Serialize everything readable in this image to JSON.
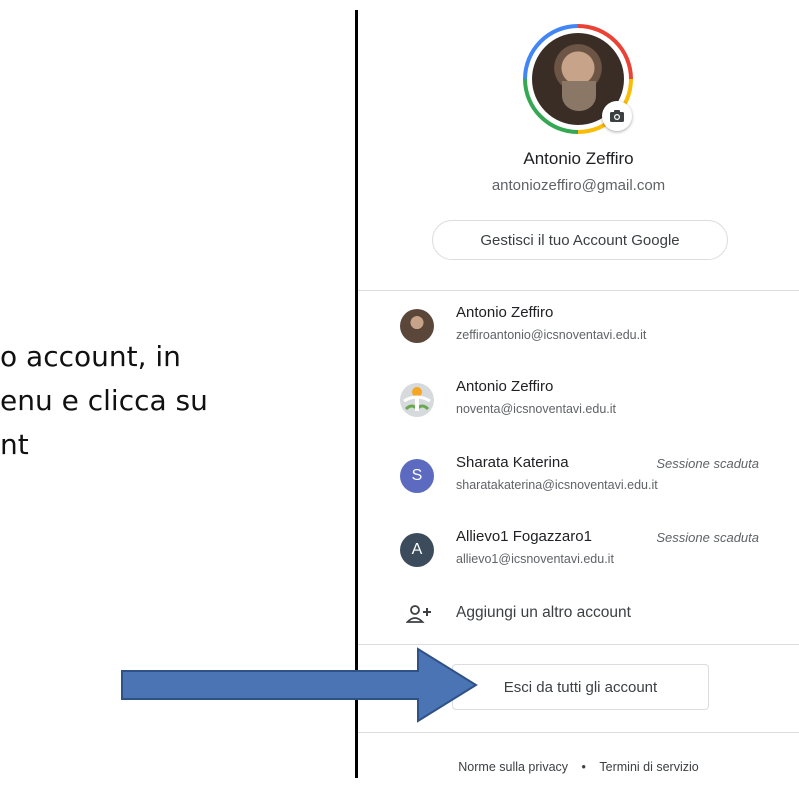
{
  "slide": {
    "line1": "o account, in",
    "line2": "enu e clicca su",
    "line3": "nt"
  },
  "profile": {
    "name": "Antonio Zeffiro",
    "email": "antoniozeffiro@gmail.com",
    "manage_label": "Gestisci il tuo Account Google"
  },
  "accounts": [
    {
      "name": "Antonio Zeffiro",
      "email": "zeffiroantonio@icsnoventavi.edu.it",
      "status": "",
      "avatar": "photo"
    },
    {
      "name": "Antonio Zeffiro",
      "email": "noventa@icsnoventavi.edu.it",
      "status": "",
      "avatar": "logo"
    },
    {
      "name": "Sharata Katerina",
      "email": "sharatakaterina@icsnoventavi.edu.it",
      "status": "Sessione scaduta",
      "avatar": "S",
      "avatar_color": "#5c6bc0"
    },
    {
      "name": "Allievo1 Fogazzaro1",
      "email": "allievo1@icsnoventavi.edu.it",
      "status": "Sessione scaduta",
      "avatar": "A",
      "avatar_color": "#3c4c5c"
    }
  ],
  "add_account_label": "Aggiungi un altro account",
  "signout_label": "Esci da tutti gli account",
  "footer": {
    "privacy": "Norme sulla privacy",
    "separator": "•",
    "terms": "Termini di servizio"
  },
  "colors": {
    "arrow_fill": "#4a74b4",
    "arrow_stroke": "#2f5286",
    "divider": "#000000"
  }
}
